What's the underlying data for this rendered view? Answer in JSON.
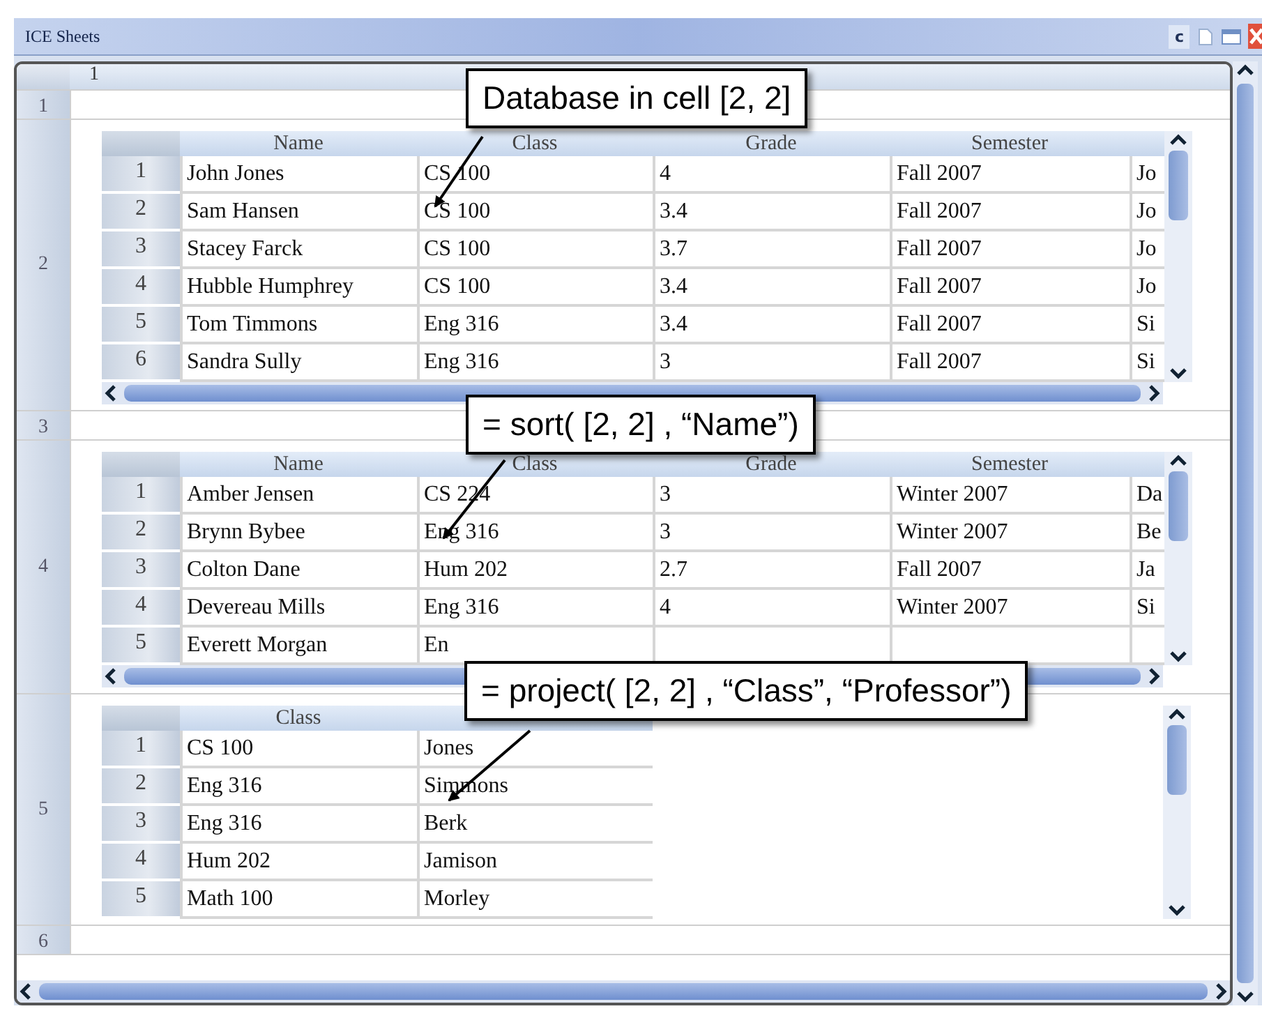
{
  "window": {
    "title": "ICE Sheets",
    "control_label": "c"
  },
  "sheet": {
    "column_header": "1",
    "rows": [
      {
        "header": "1",
        "kind": "blank"
      },
      {
        "header": "2",
        "kind": "table",
        "table": {
          "columns": [
            "Name",
            "Class",
            "Grade",
            "Semester"
          ],
          "h_scroll": true,
          "rows": [
            {
              "number": "1",
              "cells": [
                "John Jones",
                "CS 100",
                "4",
                "Fall 2007",
                "Jo"
              ]
            },
            {
              "number": "2",
              "cells": [
                "Sam Hansen",
                "CS 100",
                "3.4",
                "Fall 2007",
                "Jo"
              ]
            },
            {
              "number": "3",
              "cells": [
                "Stacey Farck",
                "CS 100",
                "3.7",
                "Fall 2007",
                "Jo"
              ]
            },
            {
              "number": "4",
              "cells": [
                "Hubble Humphrey",
                "CS 100",
                "3.4",
                "Fall 2007",
                "Jo"
              ]
            },
            {
              "number": "5",
              "cells": [
                "Tom Timmons",
                "Eng 316",
                "3.4",
                "Fall 2007",
                "Si"
              ]
            },
            {
              "number": "6",
              "cells": [
                "Sandra Sully",
                "Eng 316",
                "3",
                "Fall 2007",
                "Si"
              ]
            }
          ]
        }
      },
      {
        "header": "3",
        "kind": "blank"
      },
      {
        "header": "4",
        "kind": "table",
        "table": {
          "columns": [
            "Name",
            "Class",
            "Grade",
            "Semester"
          ],
          "h_scroll": true,
          "rows": [
            {
              "number": "1",
              "cells": [
                "Amber Jensen",
                "CS 224",
                "3",
                "Winter 2007",
                "Da"
              ]
            },
            {
              "number": "2",
              "cells": [
                "Brynn Bybee",
                "Eng 316",
                "3",
                "Winter 2007",
                "Be"
              ]
            },
            {
              "number": "3",
              "cells": [
                "Colton Dane",
                "Hum 202",
                "2.7",
                "Fall 2007",
                "Ja"
              ]
            },
            {
              "number": "4",
              "cells": [
                "Devereau Mills",
                "Eng 316",
                "4",
                "Winter 2007",
                "Si"
              ]
            },
            {
              "number": "5",
              "cells": [
                "Everett Morgan",
                "En"
              ]
            }
          ]
        }
      },
      {
        "header": "5",
        "kind": "table",
        "table": {
          "columns": [
            "Class"
          ],
          "h_scroll": false,
          "rows": [
            {
              "number": "1",
              "cells": [
                "CS 100",
                "Jones"
              ]
            },
            {
              "number": "2",
              "cells": [
                "Eng 316",
                "Simmons"
              ]
            },
            {
              "number": "3",
              "cells": [
                "Eng 316",
                "Berk"
              ]
            },
            {
              "number": "4",
              "cells": [
                "Hum 202",
                "Jamison"
              ]
            },
            {
              "number": "5",
              "cells": [
                "Math 100",
                "Morley"
              ]
            }
          ]
        }
      },
      {
        "header": "6",
        "kind": "blank"
      }
    ]
  },
  "callouts": [
    "Database in cell [2, 2]",
    "= sort( [2, 2] , “Name”)",
    "= project( [2, 2] , “Class”, “Professor”)"
  ]
}
